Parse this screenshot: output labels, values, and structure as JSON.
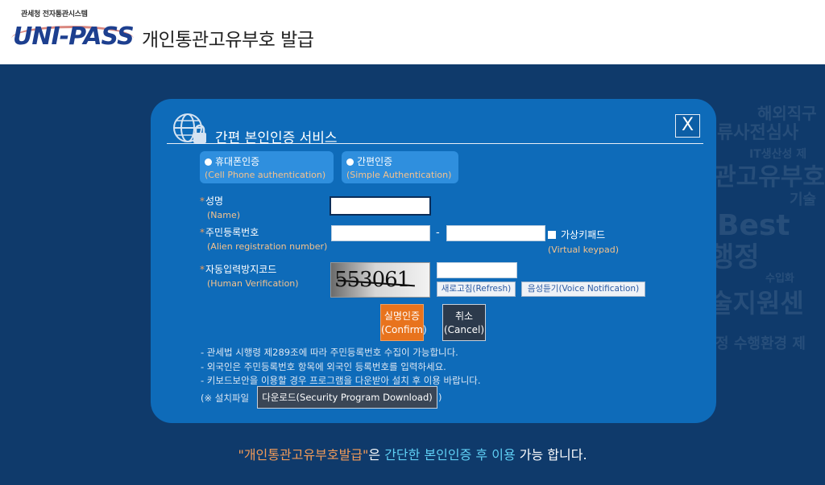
{
  "header": {
    "logo_sub": "관세청 전자통관시스템",
    "logo_main": "UNI-PASS",
    "title": "개인통관고유부호 발급"
  },
  "background": {
    "watermark_lines": [
      "해외직구",
      "류사전심사",
      "IT생산성 제",
      "관고유부호",
      "기술",
      "Best",
      "행정",
      "수입화",
      "술지원센",
      "정 수행환경 제"
    ]
  },
  "dialog": {
    "title": "간편 본인인증 서비스",
    "close_label": "X",
    "methods": [
      {
        "label": "휴대폰인증",
        "sub": "(Cell Phone authentication)"
      },
      {
        "label": "간편인증",
        "sub": "(Simple Authentication)"
      }
    ],
    "fields": {
      "name": {
        "label": "성명",
        "sub": "(Name)",
        "value": ""
      },
      "rrn": {
        "label": "주민등록번호",
        "sub": "(Alien registration number)",
        "value1": "",
        "value2": "",
        "separator": "-"
      },
      "captcha": {
        "label": "자동입력방지코드",
        "sub": "(Human Verification)",
        "image_text": "553061",
        "value": ""
      }
    },
    "required_mark": "*",
    "virtual_keypad": {
      "label": "가상키패드",
      "sub": "(Virtual keypad)",
      "checked": false
    },
    "refresh_button": "새로고침(Refresh)",
    "voice_button": "음성듣기(Voice Notification)",
    "confirm": {
      "label": "실명인증",
      "sub": "(Confirm)"
    },
    "cancel": {
      "label": "취소",
      "sub": "(Cancel)"
    },
    "notes": [
      "- 관세법 시행령 제289조에 따라 주민등록번호 수집이 가능합니다.",
      "- 외국인은 주민등록번호 항목에 외국인 등록번호를 입력하세요.",
      "- 키보드보안을 이용할 경우 프로그램을 다운받아 설치 후 이용 바랍니다."
    ],
    "download_prefix": "(※ 설치파일",
    "download_button": "다운로드(Security Program Download)",
    "download_suffix": ")"
  },
  "footer": {
    "quoted": "\"개인통관고유부호발급\"",
    "part1": "은 ",
    "highlight": "간단한 본인인증 후 이용",
    "part2": " 가능 합니다."
  },
  "colors": {
    "page_bg": "#0f3a6b",
    "dialog_bg": "#0e6bb9",
    "accent_orange": "#e8731d",
    "sub_text": "#f5c28c",
    "footer_highlight": "#5fd0f5"
  }
}
